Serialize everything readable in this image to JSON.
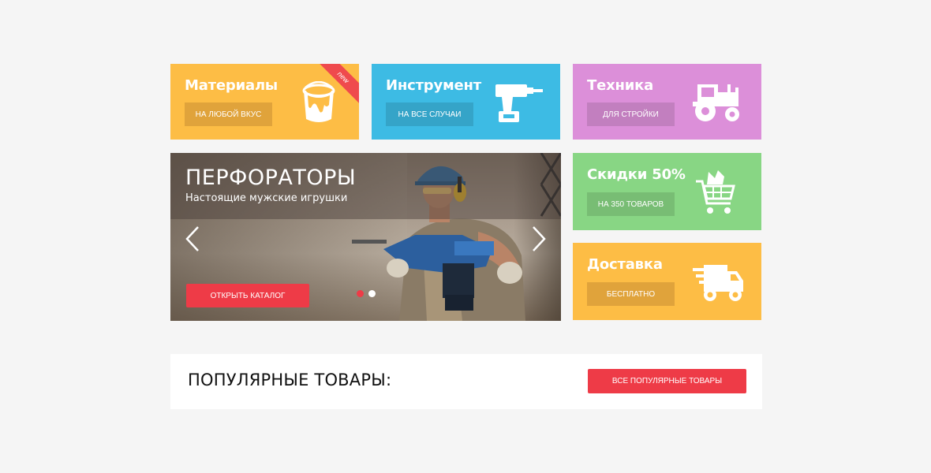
{
  "tiles": {
    "materials": {
      "title": "Материалы",
      "button": "НА ЛЮБОЙ ВКУС",
      "badge": "new",
      "icon": "paint-bucket-icon",
      "color": "#fdbd45"
    },
    "tools": {
      "title": "Инструмент",
      "button": "НА ВСЕ СЛУЧАИ",
      "icon": "drill-icon",
      "color": "#3dbbe4"
    },
    "machinery": {
      "title": "Техника",
      "button": "ДЛЯ СТРОЙКИ",
      "icon": "tractor-icon",
      "color": "#dc8fd9"
    },
    "discount": {
      "title": "Скидки 50%",
      "button": "НА 350 ТОВАРОВ",
      "icon": "shopping-cart-icon",
      "color": "#88d684"
    },
    "delivery": {
      "title": "Доставка",
      "button": "БЕСПЛАТНО",
      "icon": "delivery-truck-icon",
      "color": "#fdbd45"
    }
  },
  "slider": {
    "title": "ПЕРФОРАТОРЫ",
    "subtitle": "Настоящие мужские игрушки",
    "button": "ОТКРЫТЬ КАТАЛОГ",
    "slide_count": 2,
    "active_slide": 1
  },
  "popular": {
    "title": "ПОПУЛЯРНЫЕ ТОВАРЫ:",
    "button": "ВСЕ ПОПУЛЯРНЫЕ ТОВАРЫ"
  },
  "colors": {
    "accent": "#ee3b47",
    "background": "#f5f5f5"
  }
}
